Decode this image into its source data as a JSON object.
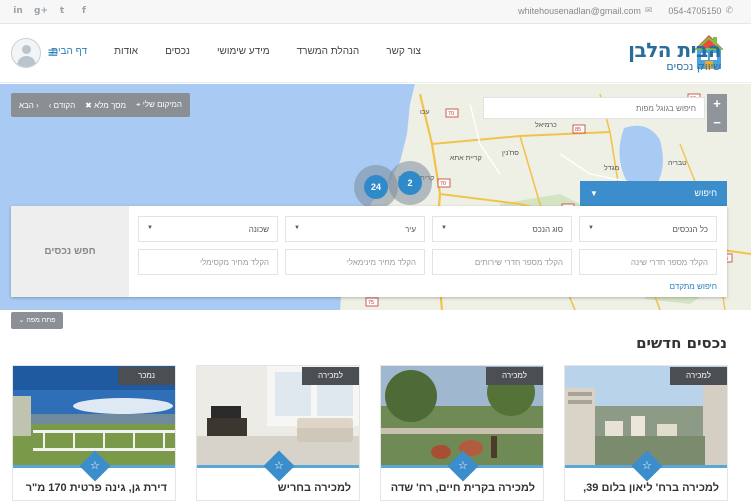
{
  "topbar": {
    "social": [
      {
        "icon": "linkedin-icon",
        "glyph": "in"
      },
      {
        "icon": "google-plus-icon",
        "glyph": "g+"
      },
      {
        "icon": "twitter-icon",
        "glyph": "t"
      },
      {
        "icon": "facebook-icon",
        "glyph": "f"
      }
    ],
    "email": "whitehousenadlan@gmail.com",
    "phone": "054-4705150"
  },
  "header": {
    "logo_name": "הבית הלבן",
    "logo_sub": "שיווק נכסים",
    "nav": [
      {
        "label": "דף הבית",
        "active": true
      },
      {
        "label": "אודות",
        "active": false
      },
      {
        "label": "נכסים",
        "active": false
      },
      {
        "label": "מידע שימושי",
        "active": false
      },
      {
        "label": "הנהלת המשרד",
        "active": false
      },
      {
        "label": "צור קשר",
        "active": false
      }
    ]
  },
  "map": {
    "toolbar": {
      "my_location": "המיקום שלי",
      "fullscreen": "מסך מלא",
      "prev": "הקודם",
      "next": "הבא"
    },
    "search_placeholder": "חיפוש בגוגל מפות",
    "clusters": [
      {
        "count": "24"
      },
      {
        "count": "2"
      }
    ],
    "places": [
      "עכו",
      "כרמיאל",
      "סח'נין",
      "טבריה",
      "קרית ביאליק",
      "מגדל",
      "נצרת עילית"
    ],
    "roads": [
      "70",
      "85",
      "77",
      "75",
      "65",
      "90"
    ]
  },
  "search": {
    "tab_label": "חיפוש",
    "panel_label": "חפש נכסים",
    "row1": [
      {
        "name": "all-properties",
        "value": "כל הנכסים"
      },
      {
        "name": "property-type",
        "value": "סוג הנכס"
      },
      {
        "name": "city",
        "value": "עיר"
      },
      {
        "name": "neighborhood",
        "value": "שכונה"
      }
    ],
    "row2": [
      {
        "name": "bedrooms",
        "placeholder": "הקלד מספר חדרי שינה"
      },
      {
        "name": "bathrooms",
        "placeholder": "הקלד מספר חדרי שירותים"
      },
      {
        "name": "min-price",
        "placeholder": "הקלד מחיר מינימאלי"
      },
      {
        "name": "max-price",
        "placeholder": "הקלד מחיר מקסימלי"
      }
    ],
    "advanced": "חיפוש מתקדם"
  },
  "open_map": "פתח מפה",
  "section": {
    "title": "נכסים חדשים"
  },
  "cards": [
    {
      "badge": "למכירה",
      "title": "למכירה ברח' ליאון בלום 39,"
    },
    {
      "badge": "למכירה",
      "title": "למכירה בקרית חיים, רח' שדה"
    },
    {
      "badge": "למכירה",
      "title": "למכירה בחריש"
    },
    {
      "badge": "נמכר",
      "title": "דירת גן, גינה פרטית 170 מ\"ר"
    }
  ]
}
